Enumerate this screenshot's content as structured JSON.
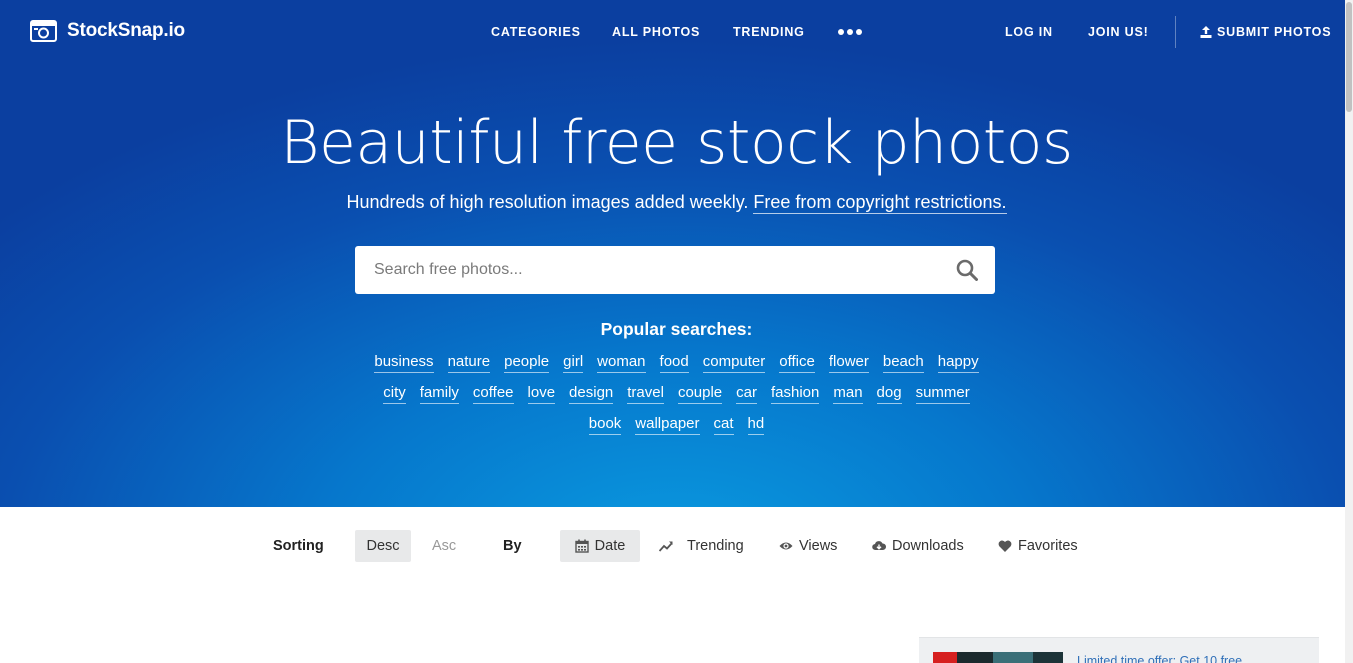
{
  "brand": {
    "name": "StockSnap.io"
  },
  "nav": {
    "categories": "CATEGORIES",
    "all_photos": "ALL PHOTOS",
    "trending": "TRENDING",
    "more_icon": "ellipsis-icon",
    "log_in": "LOG IN",
    "join_us": "JOIN US!",
    "submit_photos": "SUBMIT PHOTOS"
  },
  "hero": {
    "title": "Beautiful free stock photos",
    "subtitle_prefix": "Hundreds of high resolution images added weekly. ",
    "subtitle_link": "Free from copyright restrictions."
  },
  "search": {
    "placeholder": "Search free photos...",
    "icon": "search-icon"
  },
  "popular": {
    "title": "Popular searches:",
    "rows": [
      [
        "business",
        "nature",
        "people",
        "girl",
        "woman",
        "food",
        "computer",
        "office",
        "flower",
        "beach",
        "happy"
      ],
      [
        "city",
        "family",
        "coffee",
        "love",
        "design",
        "travel",
        "couple",
        "car",
        "fashion",
        "man",
        "dog",
        "summer"
      ],
      [
        "book",
        "wallpaper",
        "cat",
        "hd"
      ]
    ]
  },
  "sorting": {
    "label": "Sorting",
    "desc": "Desc",
    "asc": "Asc",
    "by_label": "By",
    "date": "Date",
    "trending": "Trending",
    "views": "Views",
    "downloads": "Downloads",
    "favorites": "Favorites"
  },
  "promo": {
    "text": "Limited time offer: Get 10 free"
  },
  "colors": {
    "hero_top": "#0b3fa0",
    "hero_center": "#0a9be0",
    "active_sort_bg": "#e8e9ea",
    "promo_link": "#2f6fb8"
  }
}
